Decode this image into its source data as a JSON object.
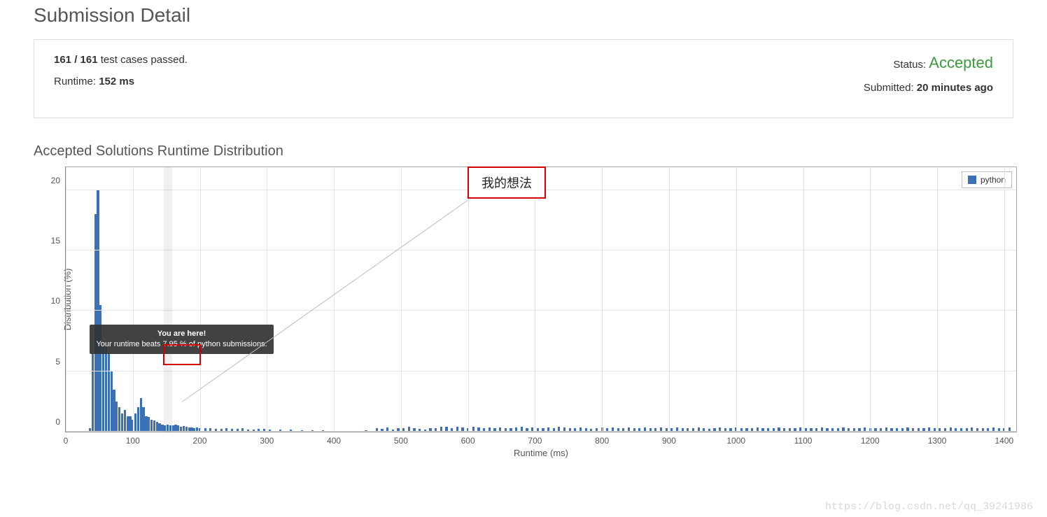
{
  "page_title": "Submission Detail",
  "panel": {
    "tests_passed_bold": "161 / 161",
    "tests_passed_rest": " test cases passed.",
    "runtime_label": "Runtime: ",
    "runtime_value": "152 ms",
    "status_label": "Status: ",
    "status_value": "Accepted",
    "submitted_label": "Submitted: ",
    "submitted_value": "20 minutes ago"
  },
  "chart_title": "Accepted Solutions Runtime Distribution",
  "legend_label": "python",
  "annotation_box_text": "我的想法",
  "tooltip": {
    "title": "You are here!",
    "body": "Your runtime beats 7.95 % of python submissions."
  },
  "watermark": "https://blog.csdn.net/qq_39241986",
  "chart_data": {
    "type": "bar",
    "xlabel": "Runtime (ms)",
    "ylabel": "Distribution (%)",
    "xlim": [
      0,
      1420
    ],
    "ylim": [
      0,
      22
    ],
    "y_ticks": [
      0,
      5,
      10,
      15,
      20
    ],
    "x_ticks": [
      0,
      100,
      200,
      300,
      400,
      500,
      600,
      700,
      800,
      900,
      1000,
      1100,
      1200,
      1300,
      1400
    ],
    "series": [
      {
        "name": "python",
        "color": "#3b6fb6",
        "x": [
          36,
          40,
          44,
          48,
          52,
          56,
          60,
          64,
          68,
          72,
          76,
          80,
          84,
          88,
          92,
          96,
          100,
          104,
          108,
          112,
          116,
          120,
          124,
          128,
          132,
          136,
          140,
          144,
          148,
          152,
          156,
          160,
          164,
          168,
          172,
          176,
          180,
          184,
          188,
          192,
          196,
          200,
          208,
          216,
          224,
          232,
          240,
          248,
          256,
          264,
          272,
          280,
          288,
          296,
          304,
          320,
          336,
          352,
          368,
          384,
          400,
          416,
          432,
          448,
          464,
          472,
          480,
          488,
          496,
          504,
          512,
          520,
          528,
          536,
          544,
          552,
          560,
          568,
          576,
          584,
          592,
          600,
          608,
          616,
          624,
          632,
          640,
          648,
          656,
          664,
          672,
          680,
          688,
          696,
          704,
          712,
          720,
          728,
          736,
          744,
          752,
          760,
          768,
          776,
          784,
          792,
          800,
          808,
          816,
          824,
          832,
          840,
          848,
          856,
          864,
          872,
          880,
          888,
          896,
          904,
          912,
          920,
          928,
          936,
          944,
          952,
          960,
          968,
          976,
          984,
          992,
          1000,
          1008,
          1016,
          1024,
          1032,
          1040,
          1048,
          1056,
          1064,
          1072,
          1080,
          1088,
          1096,
          1104,
          1112,
          1120,
          1128,
          1136,
          1144,
          1152,
          1160,
          1168,
          1176,
          1184,
          1192,
          1200,
          1208,
          1216,
          1224,
          1232,
          1240,
          1248,
          1256,
          1264,
          1272,
          1280,
          1288,
          1296,
          1304,
          1312,
          1320,
          1328,
          1336,
          1344,
          1352,
          1360,
          1368,
          1376,
          1384,
          1392,
          1400,
          1408
        ],
        "y": [
          0.3,
          6.5,
          18,
          20,
          10.5,
          7,
          7,
          6.5,
          5,
          3.5,
          2.5,
          2,
          1.5,
          1.8,
          1.3,
          1.3,
          1.0,
          1.5,
          2.0,
          2.8,
          2.0,
          1.3,
          1.2,
          1.0,
          0.9,
          0.8,
          0.7,
          0.6,
          0.5,
          0.6,
          0.5,
          0.5,
          0.6,
          0.5,
          0.4,
          0.45,
          0.4,
          0.35,
          0.35,
          0.3,
          0.35,
          0.3,
          0.3,
          0.3,
          0.25,
          0.25,
          0.3,
          0.25,
          0.25,
          0.3,
          0.2,
          0.2,
          0.25,
          0.25,
          0.2,
          0.15,
          0.15,
          0.1,
          0.1,
          0.1,
          0.08,
          0.08,
          0.05,
          0.1,
          0.3,
          0.25,
          0.35,
          0.2,
          0.3,
          0.3,
          0.4,
          0.3,
          0.25,
          0.2,
          0.3,
          0.3,
          0.4,
          0.4,
          0.3,
          0.4,
          0.35,
          0.3,
          0.4,
          0.35,
          0.3,
          0.35,
          0.3,
          0.35,
          0.3,
          0.3,
          0.35,
          0.4,
          0.3,
          0.35,
          0.3,
          0.3,
          0.35,
          0.3,
          0.4,
          0.35,
          0.3,
          0.3,
          0.35,
          0.3,
          0.25,
          0.3,
          0.35,
          0.3,
          0.35,
          0.3,
          0.3,
          0.35,
          0.3,
          0.3,
          0.35,
          0.3,
          0.3,
          0.35,
          0.3,
          0.3,
          0.35,
          0.3,
          0.3,
          0.3,
          0.35,
          0.3,
          0.25,
          0.3,
          0.35,
          0.3,
          0.3,
          0.35,
          0.3,
          0.3,
          0.3,
          0.35,
          0.3,
          0.3,
          0.3,
          0.35,
          0.3,
          0.3,
          0.3,
          0.35,
          0.3,
          0.3,
          0.3,
          0.35,
          0.3,
          0.3,
          0.3,
          0.35,
          0.3,
          0.3,
          0.3,
          0.35,
          0.3,
          0.3,
          0.3,
          0.35,
          0.3,
          0.3,
          0.3,
          0.35,
          0.3,
          0.3,
          0.3,
          0.35,
          0.3,
          0.3,
          0.3,
          0.35,
          0.3,
          0.3,
          0.3,
          0.35,
          0.3,
          0.3,
          0.3,
          0.35,
          0.3,
          0.3,
          0.35
        ]
      }
    ],
    "marker": {
      "x": 152,
      "beats_percent": 7.95
    }
  }
}
